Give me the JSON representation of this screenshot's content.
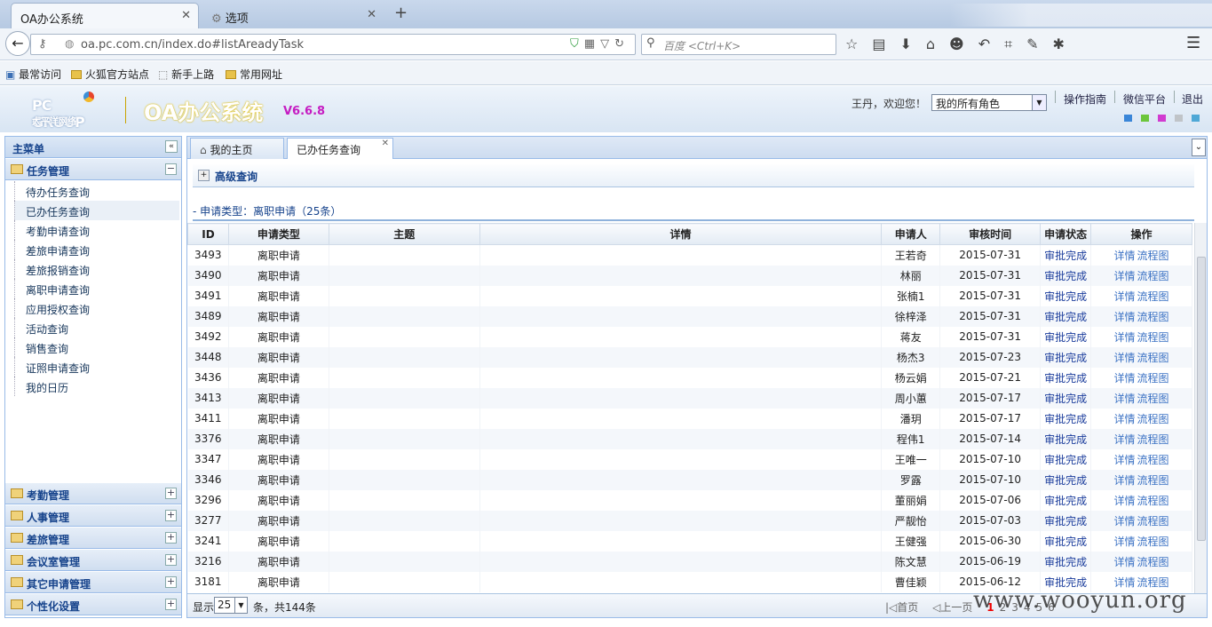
{
  "browser": {
    "tabs": [
      {
        "label": "OA办公系统"
      },
      {
        "label": "选项"
      }
    ],
    "url": "oa.pc.com.cn/index.do#listAreadyTask",
    "search_placeholder": "百度 <Ctrl+K>",
    "bookmarks": [
      "最常访问",
      "火狐官方站点",
      "新手上路",
      "常用网址"
    ]
  },
  "header": {
    "logo_text": "PC GROUP",
    "logo_sub": "太平洋网络",
    "title": "OA办公系统",
    "version": "V6.6.8",
    "welcome": "王丹，欢迎您！",
    "role_selected": "我的所有角色",
    "links": [
      "操作指南",
      "微信平台",
      "退出"
    ],
    "swatches": [
      "#3a86d8",
      "#6cc63c",
      "#d13bd0",
      "#c0c4c8",
      "#4fa8d6"
    ]
  },
  "sidebar": {
    "title": "主菜单",
    "task_section": "任务管理",
    "task_items": [
      "待办任务查询",
      "已办任务查询",
      "考勤申请查询",
      "差旅申请查询",
      "差旅报销查询",
      "离职申请查询",
      "应用授权查询",
      "活动查询",
      "销售查询",
      "证照申请查询",
      "我的日历"
    ],
    "sections": [
      "考勤管理",
      "人事管理",
      "差旅管理",
      "会议室管理",
      "其它申请管理",
      "个性化设置"
    ]
  },
  "main": {
    "tabs": [
      "我的主页",
      "已办任务查询"
    ],
    "adv_search": "高级查询",
    "list_title": "- 申请类型：离职申请（25条）",
    "columns": [
      "ID",
      "申请类型",
      "主题",
      "详情",
      "申请人",
      "审核时间",
      "申请状态",
      "操作"
    ],
    "op_detail": "详情",
    "op_flow": "流程图",
    "rows": [
      [
        "3493",
        "离职申请",
        "",
        "",
        "王若奇",
        "2015-07-31",
        "审批完成"
      ],
      [
        "3490",
        "离职申请",
        "",
        "",
        "林丽",
        "2015-07-31",
        "审批完成"
      ],
      [
        "3491",
        "离职申请",
        "",
        "",
        "张楠1",
        "2015-07-31",
        "审批完成"
      ],
      [
        "3489",
        "离职申请",
        "",
        "",
        "徐梓泽",
        "2015-07-31",
        "审批完成"
      ],
      [
        "3492",
        "离职申请",
        "",
        "",
        "蒋友",
        "2015-07-31",
        "审批完成"
      ],
      [
        "3448",
        "离职申请",
        "",
        "",
        "杨杰3",
        "2015-07-23",
        "审批完成"
      ],
      [
        "3436",
        "离职申请",
        "",
        "",
        "杨云娟",
        "2015-07-21",
        "审批完成"
      ],
      [
        "3413",
        "离职申请",
        "",
        "",
        "周小蕙",
        "2015-07-17",
        "审批完成"
      ],
      [
        "3411",
        "离职申请",
        "",
        "",
        "潘玥",
        "2015-07-17",
        "审批完成"
      ],
      [
        "3376",
        "离职申请",
        "",
        "",
        "程伟1",
        "2015-07-14",
        "审批完成"
      ],
      [
        "3347",
        "离职申请",
        "",
        "",
        "王唯一",
        "2015-07-10",
        "审批完成"
      ],
      [
        "3346",
        "离职申请",
        "",
        "",
        "罗露",
        "2015-07-10",
        "审批完成"
      ],
      [
        "3296",
        "离职申请",
        "",
        "",
        "董丽娟",
        "2015-07-06",
        "审批完成"
      ],
      [
        "3277",
        "离职申请",
        "",
        "",
        "严靓怡",
        "2015-07-03",
        "审批完成"
      ],
      [
        "3241",
        "离职申请",
        "",
        "",
        "王健强",
        "2015-06-30",
        "审批完成"
      ],
      [
        "3216",
        "离职申请",
        "",
        "",
        "陈文慧",
        "2015-06-19",
        "审批完成"
      ],
      [
        "3181",
        "离职申请",
        "",
        "",
        "曹佳颖",
        "2015-06-12",
        "审批完成"
      ]
    ],
    "pager": {
      "show_label": "显示",
      "page_size": "25",
      "total": "条，共144条",
      "first": "首页",
      "prev": "上一页",
      "pages": [
        "1",
        "2",
        "3",
        "4",
        "5",
        "6"
      ],
      "current": "1"
    }
  },
  "watermark": "www.wooyun.org"
}
